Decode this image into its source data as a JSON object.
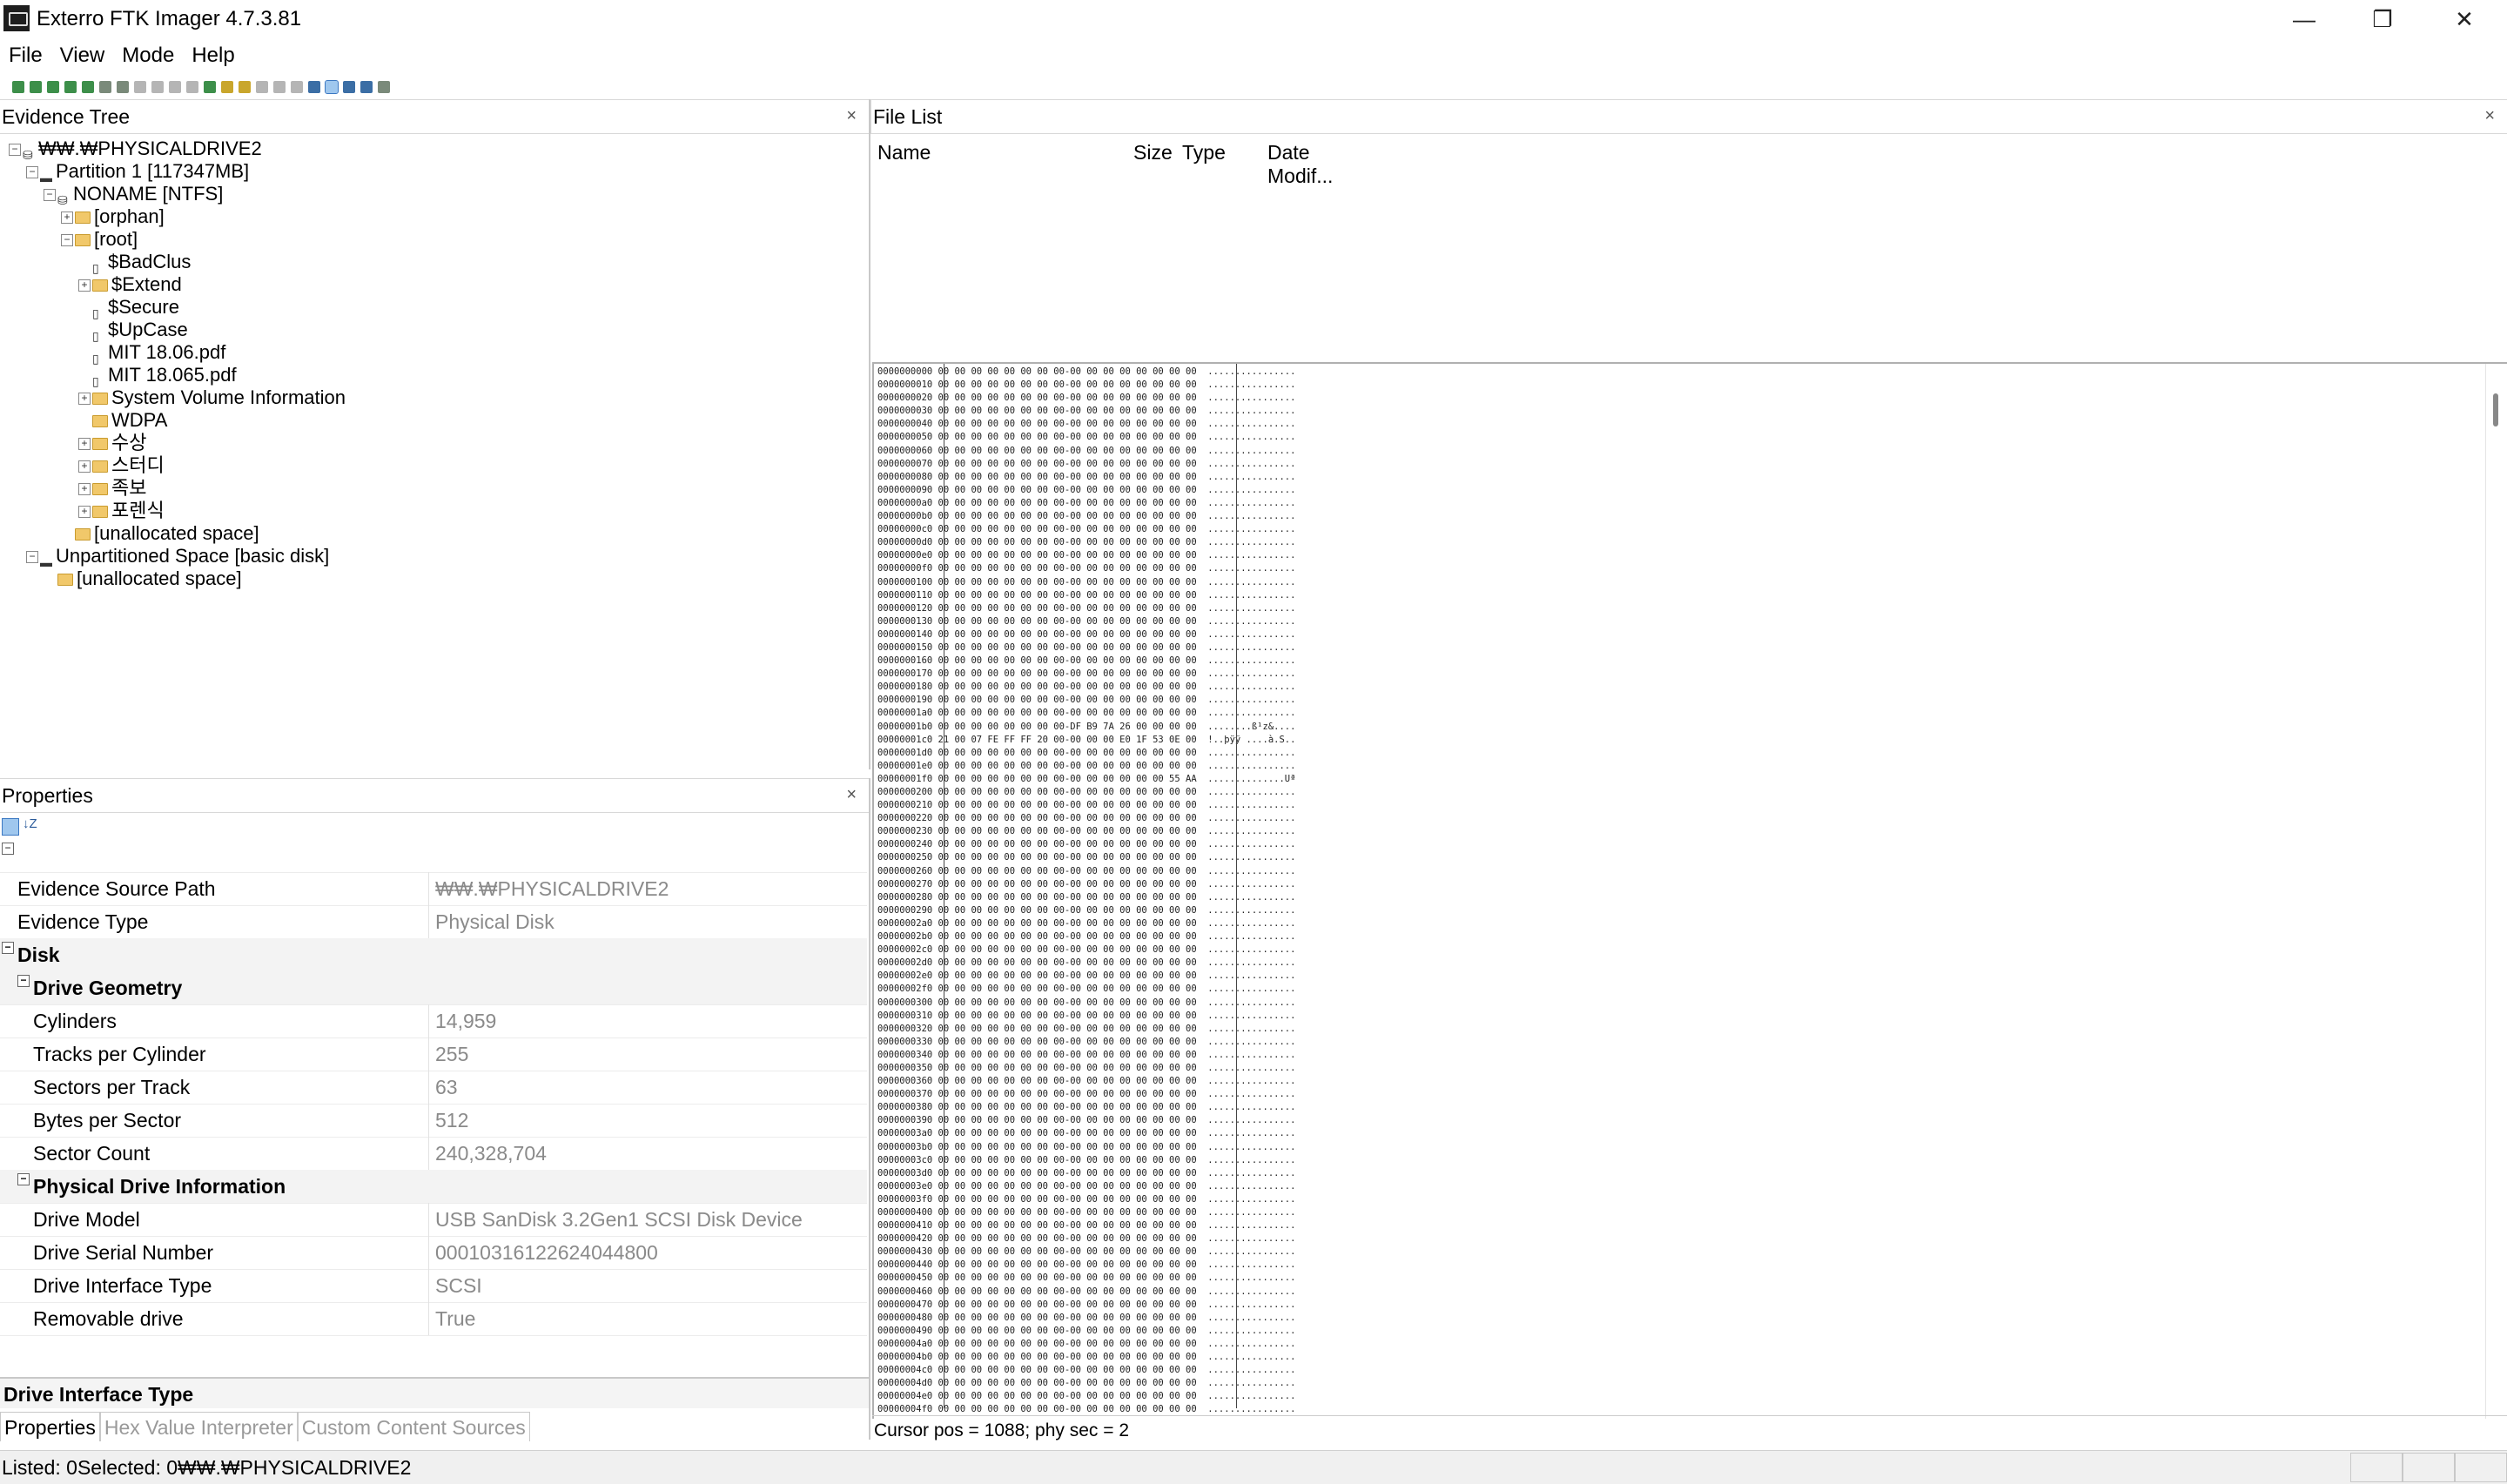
{
  "window": {
    "title": "Exterro FTK Imager 4.7.3.81",
    "controls": {
      "minimize": "—",
      "restore": "❐",
      "close": "✕"
    }
  },
  "menu": [
    "File",
    "View",
    "Mode",
    "Help"
  ],
  "evidence_tree": {
    "title": "Evidence Tree",
    "close": "×",
    "items": [
      {
        "label": "₩₩.₩PHYSICALDRIVE2",
        "expander": "−"
      },
      {
        "label": "Partition 1 [117347MB]",
        "expander": "−"
      },
      {
        "label": "NONAME [NTFS]",
        "expander": "−"
      },
      {
        "label": "[orphan]",
        "expander": "+"
      },
      {
        "label": "[root]",
        "expander": "−"
      },
      {
        "label": "$BadClus"
      },
      {
        "label": "$Extend",
        "expander": "+"
      },
      {
        "label": "$Secure"
      },
      {
        "label": "$UpCase"
      },
      {
        "label": "MIT 18.06.pdf"
      },
      {
        "label": "MIT 18.065.pdf"
      },
      {
        "label": "System Volume Information",
        "expander": "+"
      },
      {
        "label": "WDPA"
      },
      {
        "label": "수상",
        "expander": "+"
      },
      {
        "label": "스터디",
        "expander": "+"
      },
      {
        "label": "족보",
        "expander": "+"
      },
      {
        "label": "포렌식",
        "expander": "+"
      },
      {
        "label": "[unallocated space]"
      },
      {
        "label": "Unpartitioned Space [basic disk]",
        "expander": "−"
      },
      {
        "label": "[unallocated space]"
      }
    ]
  },
  "file_list": {
    "title": "File List",
    "close": "×",
    "columns": [
      "Name",
      "Size",
      "Type",
      "Date Modif..."
    ]
  },
  "hex_view": {
    "row_count": 80,
    "zero_bytes": "00 00 00 00 00 00 00 00-00 00 00 00 00 00 00 00",
    "zero_ascii": "................",
    "special_rows": {
      "1b0": {
        "hex": "00 00 00 00 00 00 00 00-DF B9 7A 26 00 00 00 00",
        "ascii": "........ß¹z&...."
      },
      "1c0": {
        "hex": "21 00 07 FE FF FF 20 00-00 00 00 E0 1F 53 0E 00",
        "ascii": "!..þÿÿ ....à.S.."
      },
      "1f0": {
        "hex": "00 00 00 00 00 00 00 00-00 00 00 00 00 00 55 AA",
        "ascii": "..............Uª"
      }
    },
    "cursor_status": "Cursor pos = 1088; phy sec = 2"
  },
  "properties": {
    "title": "Properties",
    "close": "×",
    "toolbar_icons": [
      "categorized-icon",
      "alphabetical-icon"
    ],
    "az_label": "↓Z",
    "rows": [
      {
        "type": "blank",
        "exp": "−"
      },
      {
        "type": "prop",
        "label": "Evidence Source Path",
        "value": "₩₩.₩PHYSICALDRIVE2",
        "indent": 0
      },
      {
        "type": "prop",
        "label": "Evidence Type",
        "value": "Physical Disk",
        "indent": 0
      },
      {
        "type": "cat",
        "label": "Disk",
        "exp": "−",
        "indent": 0
      },
      {
        "type": "cat",
        "label": "Drive Geometry",
        "exp": "−",
        "indent": 1
      },
      {
        "type": "prop",
        "label": "Cylinders",
        "value": "14,959",
        "indent": 1
      },
      {
        "type": "prop",
        "label": "Tracks per Cylinder",
        "value": "255",
        "indent": 1
      },
      {
        "type": "prop",
        "label": "Sectors per Track",
        "value": "63",
        "indent": 1
      },
      {
        "type": "prop",
        "label": "Bytes per Sector",
        "value": "512",
        "indent": 1
      },
      {
        "type": "prop",
        "label": "Sector Count",
        "value": "240,328,704",
        "indent": 1
      },
      {
        "type": "cat",
        "label": "Physical Drive Information",
        "exp": "−",
        "indent": 1
      },
      {
        "type": "prop",
        "label": "Drive Model",
        "value": " USB  SanDisk 3.2Gen1 SCSI Disk Device",
        "indent": 1
      },
      {
        "type": "prop",
        "label": "Drive Serial Number",
        "value": "00010316122624044800",
        "indent": 1
      },
      {
        "type": "prop",
        "label": "Drive Interface Type",
        "value": "SCSI",
        "indent": 1
      },
      {
        "type": "prop",
        "label": "Removable drive",
        "value": "True",
        "indent": 1
      }
    ],
    "description_title": "Drive Interface Type",
    "tabs": [
      "Properties",
      "Hex Value Interpreter",
      "Custom Content Sources"
    ]
  },
  "status_bar": {
    "text": "Listed: 0Selected: 0₩₩.₩PHYSICALDRIVE2"
  }
}
